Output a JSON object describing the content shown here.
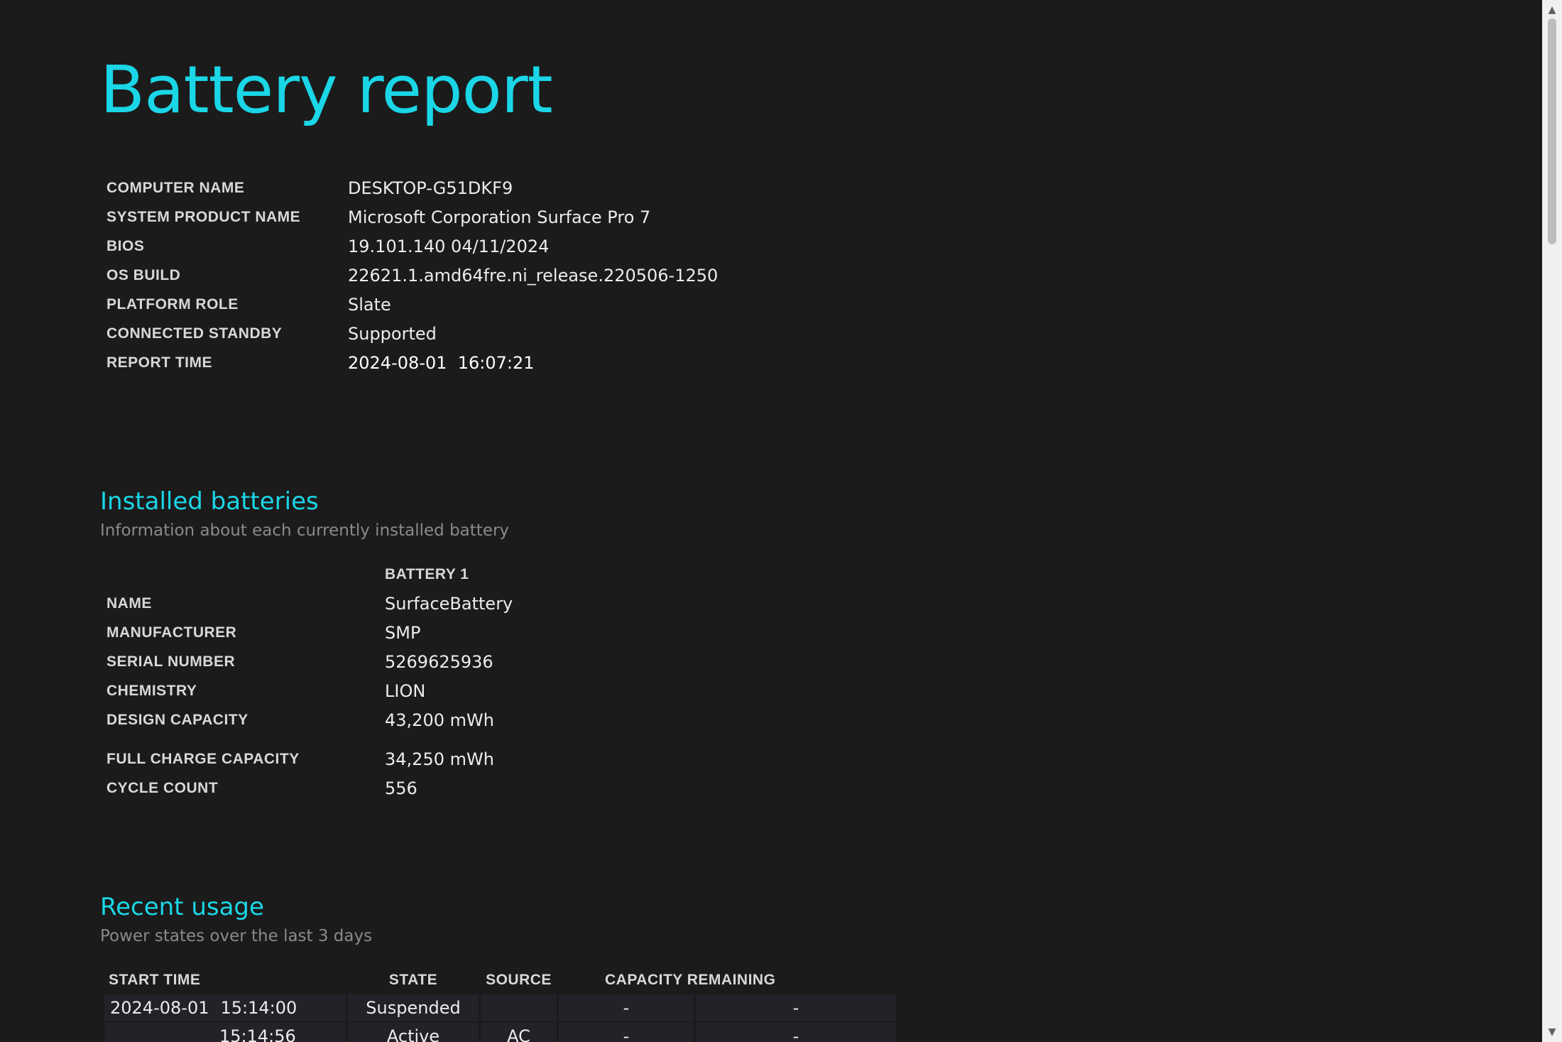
{
  "title": "Battery report",
  "system_info": [
    {
      "label": "COMPUTER NAME",
      "value": "DESKTOP-G51DKF9"
    },
    {
      "label": "SYSTEM PRODUCT NAME",
      "value": "Microsoft Corporation Surface Pro 7"
    },
    {
      "label": "BIOS",
      "value": "19.101.140 04/11/2024"
    },
    {
      "label": "OS BUILD",
      "value": "22621.1.amd64fre.ni_release.220506-1250"
    },
    {
      "label": "PLATFORM ROLE",
      "value": "Slate"
    },
    {
      "label": "CONNECTED STANDBY",
      "value": "Supported"
    },
    {
      "label": "REPORT TIME",
      "value": "2024-08-01  16:07:21"
    }
  ],
  "installed_batteries": {
    "title": "Installed batteries",
    "subtitle": "Information about each currently installed battery",
    "column": "BATTERY 1",
    "rows": [
      {
        "label": "NAME",
        "value": "SurfaceBattery"
      },
      {
        "label": "MANUFACTURER",
        "value": "SMP"
      },
      {
        "label": "SERIAL NUMBER",
        "value": "5269625936"
      },
      {
        "label": "CHEMISTRY",
        "value": "LION"
      },
      {
        "label": "DESIGN CAPACITY",
        "value": "43,200 mWh"
      },
      {
        "label": "FULL CHARGE CAPACITY",
        "value": "34,250 mWh"
      },
      {
        "label": "CYCLE COUNT",
        "value": "556"
      }
    ]
  },
  "recent_usage": {
    "title": "Recent usage",
    "subtitle": "Power states over the last 3 days",
    "headers": {
      "start_time": "START TIME",
      "state": "STATE",
      "source": "SOURCE",
      "capacity_remaining": "CAPACITY REMAINING"
    },
    "rows": [
      {
        "date": "2024-08-01",
        "time": "15:14:00",
        "state": "Suspended",
        "source": "",
        "pct": "-",
        "mwh": "-"
      },
      {
        "date": "",
        "time": "15:14:56",
        "state": "Active",
        "source": "AC",
        "pct": "-",
        "mwh": "-"
      }
    ]
  }
}
